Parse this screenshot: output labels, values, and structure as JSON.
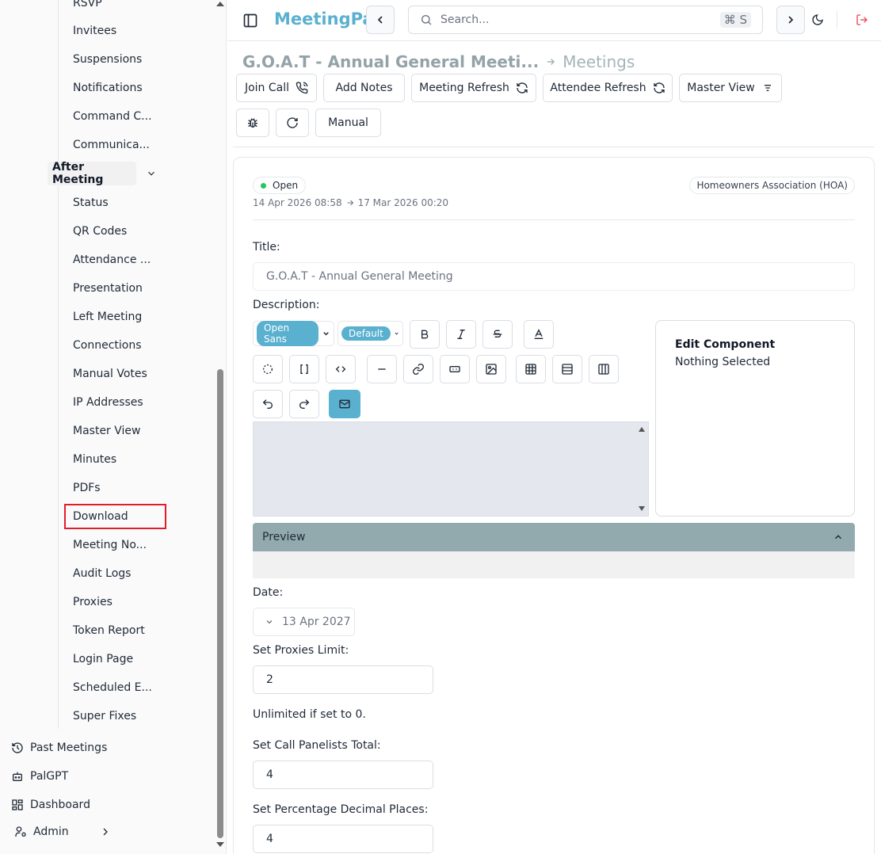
{
  "sidebar": {
    "items": [
      "RSVP",
      "Invitees",
      "Suspensions",
      "Notifications",
      "Command C...",
      "Communica..."
    ],
    "group_label": "After Meeting",
    "group_items": [
      "Status",
      "QR Codes",
      "Attendance ...",
      "Presentation",
      "Left Meeting",
      "Connections",
      "Manual Votes",
      "IP Addresses",
      "Master View",
      "Minutes",
      "PDFs",
      "Download",
      "Meeting No...",
      "Audit Logs",
      "Proxies",
      "Token Report",
      "Login Page",
      "Scheduled E...",
      "Super Fixes"
    ],
    "bottom": [
      {
        "label": "Past Meetings",
        "icon": "history-icon"
      },
      {
        "label": "PalGPT",
        "icon": "bot-icon"
      },
      {
        "label": "Dashboard",
        "icon": "dashboard-icon"
      },
      {
        "label": "Admin",
        "icon": "user-cog-icon"
      }
    ]
  },
  "topbar": {
    "brand": "MeetingPal",
    "search_placeholder": "Search...",
    "shortcut": "⌘ S"
  },
  "header": {
    "title": "G.O.A.T - Annual General Meeti...",
    "section": "Meetings",
    "buttons": {
      "join_call": "Join Call",
      "add_notes": "Add Notes",
      "meeting_refresh": "Meeting Refresh",
      "attendee_refresh": "Attendee Refresh",
      "master_view": "Master View",
      "manual": "Manual"
    }
  },
  "meeting": {
    "status": "Open",
    "start": "14 Apr 2026 08:58",
    "end": "17 Mar 2026 00:20",
    "org": "Homeowners Association (HOA)"
  },
  "form": {
    "title_label": "Title:",
    "title_value": "G.O.A.T - Annual General Meeting",
    "description_label": "Description:",
    "font_family": "Open Sans",
    "font_size": "Default",
    "edit_component_title": "Edit Component",
    "edit_component_empty": "Nothing Selected",
    "preview_label": "Preview",
    "date_label": "Date:",
    "date_value": "13 Apr 2027",
    "proxies_label": "Set Proxies Limit:",
    "proxies_value": "2",
    "proxies_note": "Unlimited if set to 0.",
    "panelists_label": "Set Call Panelists Total:",
    "panelists_value": "4",
    "decimals_label": "Set Percentage Decimal Places:",
    "decimals_value": "4"
  },
  "colors": {
    "accent": "#5ab0cf",
    "highlight": "#e11d2c",
    "preview": "#92aaae"
  }
}
